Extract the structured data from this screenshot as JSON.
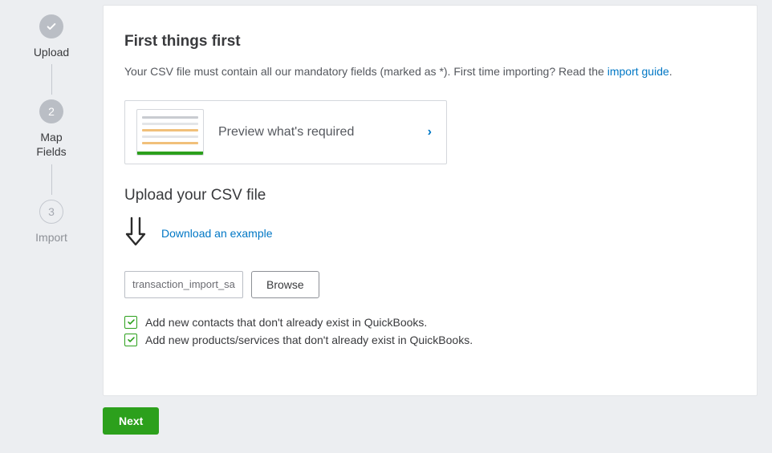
{
  "stepper": {
    "step1": {
      "label": "Upload"
    },
    "step2": {
      "num": "2",
      "label": "Map\nFields"
    },
    "step3": {
      "num": "3",
      "label": "Import"
    }
  },
  "intro": {
    "heading": "First things first",
    "text_before_link": "Your CSV file must contain all our mandatory fields (marked as *). First time importing? Read the ",
    "link": "import guide",
    "text_after_link": "."
  },
  "preview": {
    "label": "Preview what's required"
  },
  "upload": {
    "heading": "Upload your CSV file",
    "download_link": "Download an example",
    "file_value": "transaction_import_sample.csv",
    "browse_label": "Browse"
  },
  "checks": {
    "contacts": "Add new contacts that don't already exist in QuickBooks.",
    "products": "Add new products/services that don't already exist in QuickBooks."
  },
  "actions": {
    "next": "Next"
  }
}
